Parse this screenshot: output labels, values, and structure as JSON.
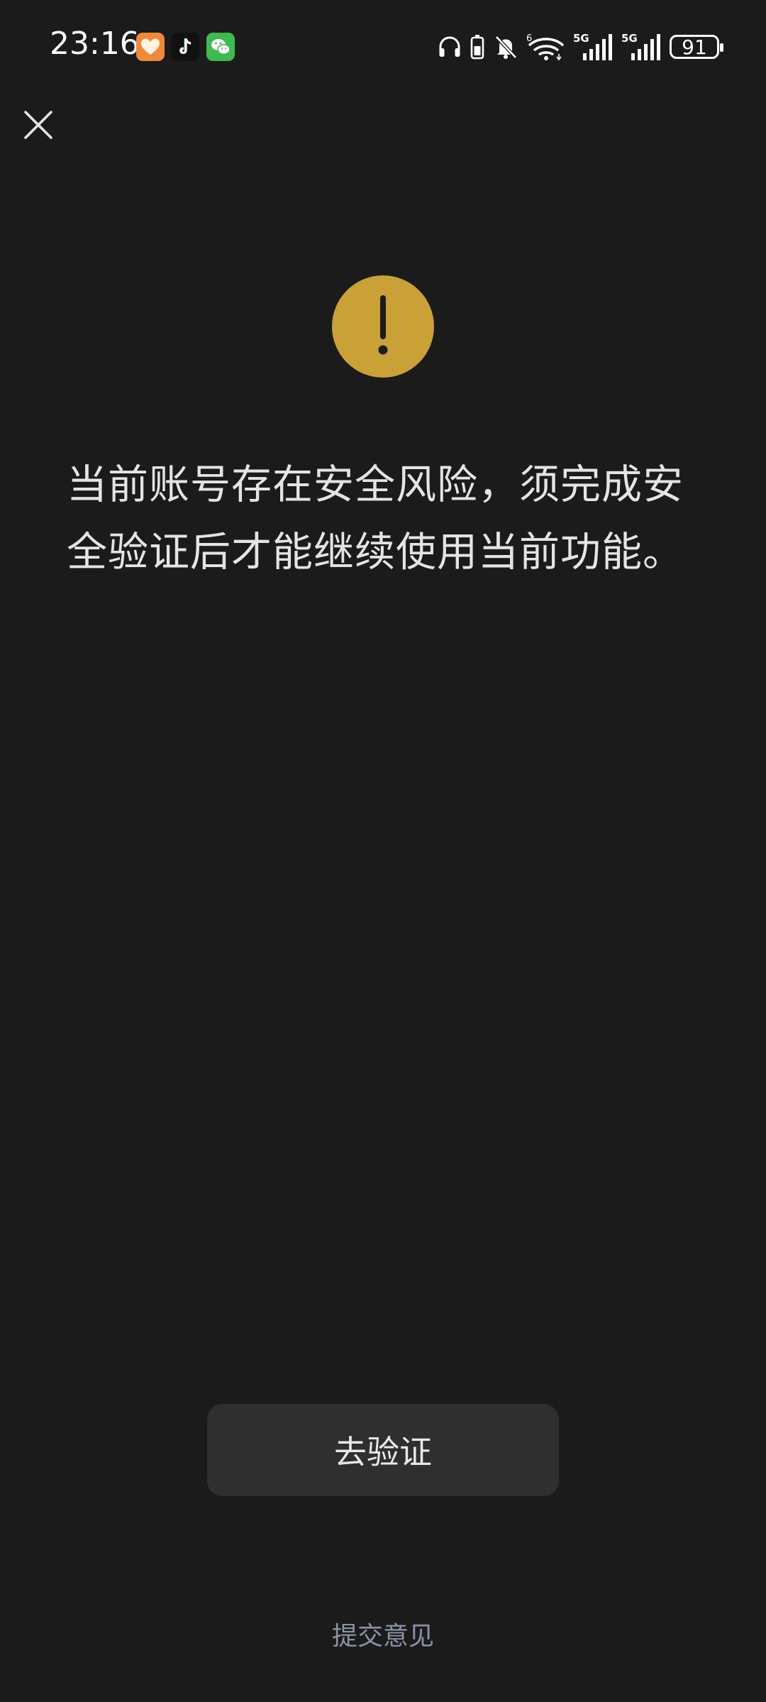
{
  "status_bar": {
    "time": "23:16",
    "app_icons": [
      "heart-app-icon",
      "tiktok-icon",
      "wechat-icon"
    ],
    "system_icons": [
      "headphones-icon",
      "battery-saver-icon",
      "mute-icon",
      "wifi-icon",
      "signal-5g-icon",
      "signal-5g-icon"
    ],
    "network_labels": [
      "6",
      "5G",
      "5G"
    ],
    "battery_level": "91"
  },
  "header": {
    "close_icon": "close-icon"
  },
  "alert": {
    "icon": "warning-icon",
    "icon_color": "#c9a136",
    "message": "当前账号存在安全风险，须完成安全验证后才能继续使用当前功能。"
  },
  "actions": {
    "verify_label": "去验证",
    "feedback_label": "提交意见"
  },
  "colors": {
    "background": "#1b1b1b",
    "button_bg": "#2f2f2f",
    "link": "#8c93a6"
  }
}
